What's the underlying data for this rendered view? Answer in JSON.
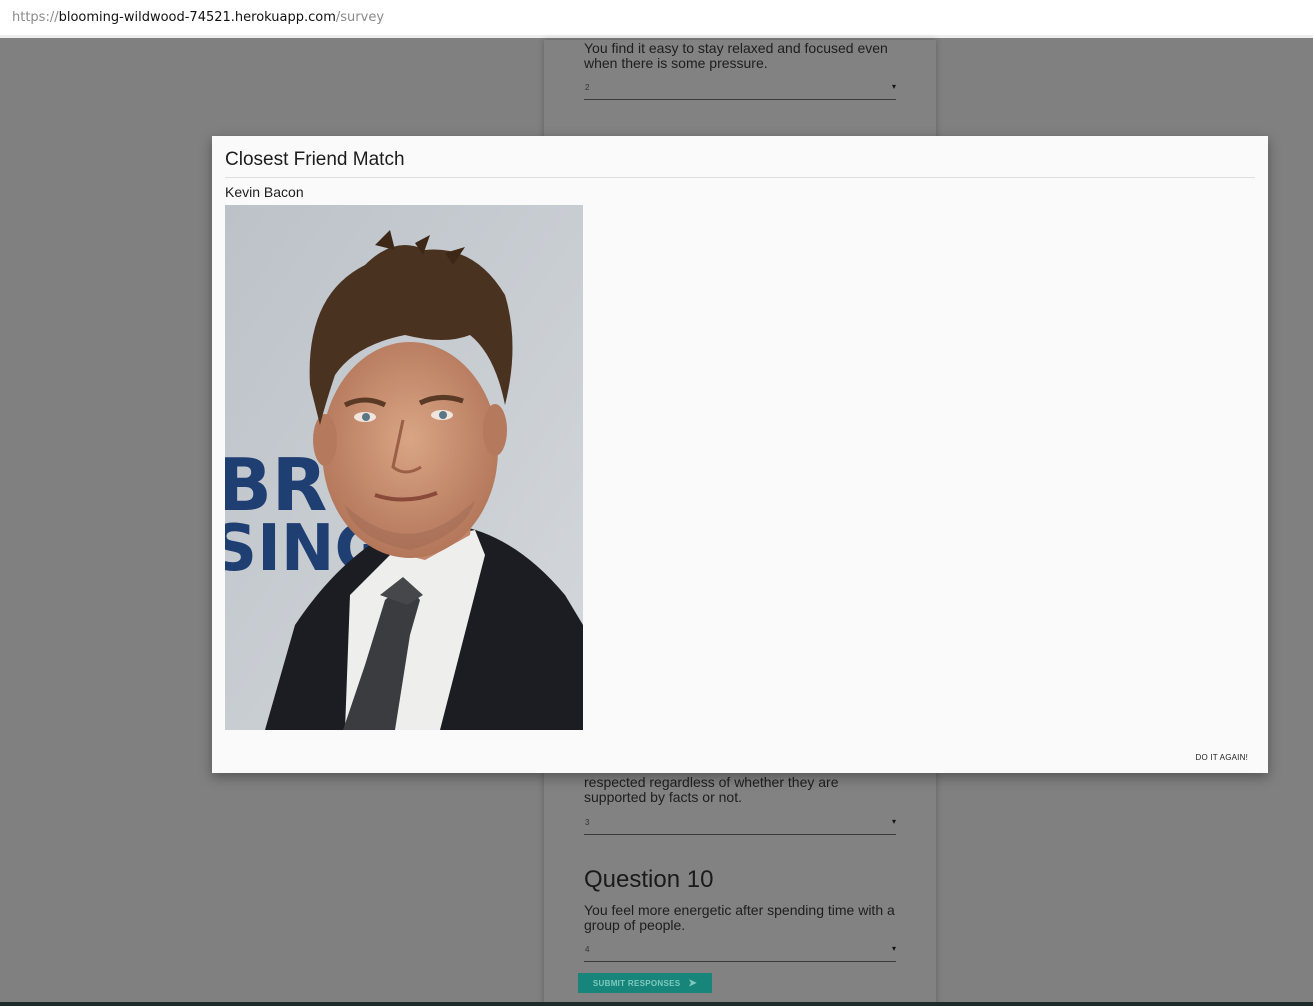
{
  "browser": {
    "url_scheme": "https://",
    "url_host": "blooming-wildwood-74521.herokuapp.com",
    "url_path": "/survey"
  },
  "survey": {
    "q_top_text": "You find it easy to stay relaxed and focused even when there is some pressure.",
    "q_top_value": "2",
    "q9_text": "respected regardless of whether they are supported by facts or not.",
    "q9_value": "3",
    "q10_heading": "Question 10",
    "q10_text": "You feel more energetic after spending time with a group of people.",
    "q10_value": "4",
    "submit_label": "SUBMIT RESPONSES",
    "select_arrow": "▾",
    "send_icon": "➤"
  },
  "modal": {
    "title": "Closest Friend Match",
    "friend_name": "Kevin Bacon",
    "photo_backdrop_text": [
      "BRY",
      "SING"
    ],
    "do_again_label": "DO IT AGAIN!"
  }
}
